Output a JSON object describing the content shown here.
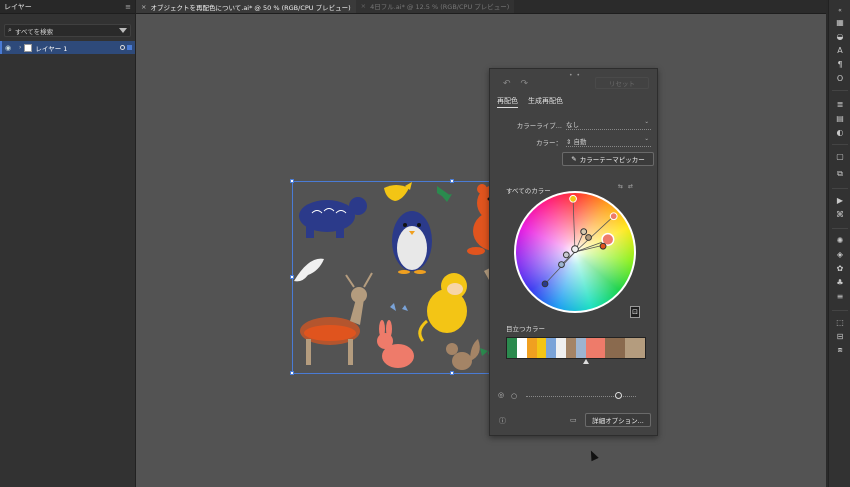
{
  "layers_panel": {
    "tab_label": "レイヤー",
    "search_placeholder": "すべてを検索",
    "layer_name": "レイヤー 1"
  },
  "document_tabs": [
    {
      "label": "オブジェクトを再配色について.ai* @ 50 % (RGB/CPU プレビュー)",
      "active": true
    },
    {
      "label": "4日フル.ai* @ 12.5 % (RGB/CPU プレビュー)",
      "active": false
    }
  ],
  "recolor_panel": {
    "reset_label": "リセット",
    "tab_recolor": "再配色",
    "tab_generative": "生成再配色",
    "color_library_label": "カラーライブ...",
    "color_library_value": "なし",
    "colors_label": "カラー：",
    "colors_value": "自動",
    "theme_picker_label": "カラーテーマピッカー",
    "all_colors_label": "すべてのカラー",
    "prominent_colors_label": "目立つカラー",
    "advanced_options_label": "詳細オプション...",
    "prominent_swatches": [
      "#2b8a4e",
      "#ffffff",
      "#f0a020",
      "#f3c515",
      "#7aa3d8",
      "#f0f0f0",
      "#a48466",
      "#9db4d0",
      "#ee7b6a",
      "#ee7b6a",
      "#8a6a4e",
      "#8a6a4e",
      "#b49c7e",
      "#b49c7e"
    ],
    "swatch_pointer_fraction": 0.57
  },
  "colors": {
    "accent": "#4a7bd4",
    "panel_bg": "#424242",
    "canvas_bg": "#535353"
  }
}
